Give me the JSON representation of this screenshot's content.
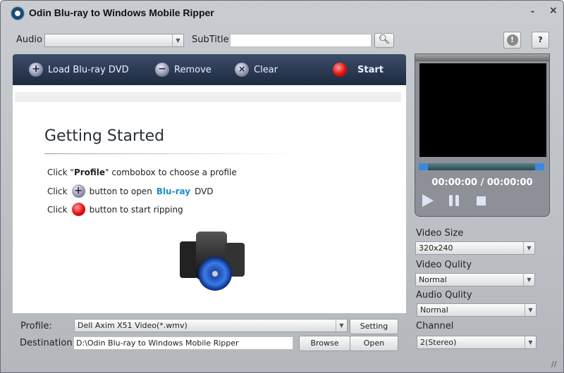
{
  "window": {
    "title": "Odin Blu-ray to Windows Mobile Ripper",
    "minimize": "-",
    "close": "×"
  },
  "top": {
    "audio_label": "Audio",
    "audio_value": "",
    "subtitle_label": "SubTitle",
    "subtitle_value": "",
    "info": "!",
    "help": "?"
  },
  "toolbar": {
    "load": "Load Blu-ray DVD",
    "remove": "Remove",
    "clear": "Clear",
    "start": "Start"
  },
  "getting_started": {
    "title": "Getting Started",
    "line1_pre": "Click \"",
    "line1_bold": "Profile",
    "line1_post": "\" combobox to choose a profile",
    "line2_pre": "Click",
    "line2_mid": "button to open",
    "line2_brand": "Blu-ray",
    "line2_post": "DVD",
    "line3_pre": "Click",
    "line3_post": "button to start ripping"
  },
  "player": {
    "time": "00:00:00 / 00:00:00",
    "progress": 0
  },
  "settings": {
    "video_size_label": "Video Size",
    "video_size": "320x240",
    "video_quality_label": "Video Qulity",
    "video_quality": "Normal",
    "audio_quality_label": "Audio Qulity",
    "audio_quality": "Normal",
    "channel_label": "Channel",
    "channel": "2(Stereo)"
  },
  "bottom": {
    "profile_label": "Profile:",
    "profile_value": "Dell Axim X51 Video(*.wmv)",
    "setting": "Setting",
    "destination_label": "Destination:",
    "destination_value": "D:\\Odin Blu-ray to Windows Mobile Ripper",
    "browse": "Browse",
    "open": "Open"
  },
  "colors": {
    "brand": "#1a8ccc",
    "toolbar": "#2a3a54"
  }
}
